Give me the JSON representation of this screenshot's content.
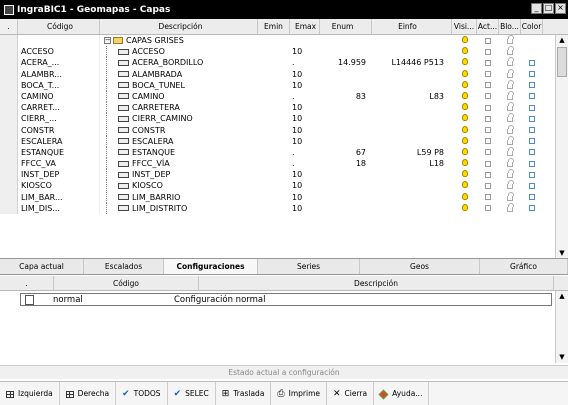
{
  "window": {
    "title": "IngraBIC1 - Geomapas - Capas",
    "buttons": [
      "_",
      "□",
      "×"
    ]
  },
  "grid": {
    "columns": [
      ".",
      "Código",
      "Descripción",
      "Emin",
      "Emax",
      "Enum",
      "Einfo",
      "Visi...",
      "Act...",
      "Blo...",
      "Color"
    ],
    "group_label": "CAPAS GRISES",
    "rows": [
      {
        "codigo": "ACCESO",
        "descripcion": "ACCESO",
        "emin": "",
        "emax": "10",
        "enum": "",
        "einfo": "",
        "color": false
      },
      {
        "codigo": "ACERA_...",
        "descripcion": "ACERA_BORDILLO",
        "emin": "",
        "emax": ".",
        "enum": "14.959",
        "einfo": "L14446 P513",
        "color": true
      },
      {
        "codigo": "ALAMBR...",
        "descripcion": "ALAMBRADA",
        "emin": "",
        "emax": "10",
        "enum": "",
        "einfo": "",
        "color": true
      },
      {
        "codigo": "BOCA_T...",
        "descripcion": "BOCA_TUNEL",
        "emin": "",
        "emax": "10",
        "enum": "",
        "einfo": "",
        "color": true
      },
      {
        "codigo": "CAMINO",
        "descripcion": "CAMINO",
        "emin": "",
        "emax": ".",
        "enum": "83",
        "einfo": "L83",
        "color": true
      },
      {
        "codigo": "CARRET...",
        "descripcion": "CARRETERA",
        "emin": "",
        "emax": "10",
        "enum": "",
        "einfo": "",
        "color": true
      },
      {
        "codigo": "CIERR_...",
        "descripcion": "CIERR_CAMINO",
        "emin": "",
        "emax": "10",
        "enum": "",
        "einfo": "",
        "color": true
      },
      {
        "codigo": "CONSTR",
        "descripcion": "CONSTR",
        "emin": "",
        "emax": "10",
        "enum": "",
        "einfo": "",
        "color": true
      },
      {
        "codigo": "ESCALERA",
        "descripcion": "ESCALERA",
        "emin": "",
        "emax": "10",
        "enum": "",
        "einfo": "",
        "color": true
      },
      {
        "codigo": "ESTANQUE",
        "descripcion": "ESTANQUE",
        "emin": "",
        "emax": ".",
        "enum": "67",
        "einfo": "L59 P8",
        "color": true
      },
      {
        "codigo": "FFCC_VA",
        "descripcion": "FFCC_VÍA",
        "emin": "",
        "emax": ".",
        "enum": "18",
        "einfo": "L18",
        "color": true
      },
      {
        "codigo": "INST_DEP",
        "descripcion": "INST_DEP",
        "emin": "",
        "emax": "10",
        "enum": "",
        "einfo": "",
        "color": true
      },
      {
        "codigo": "KIOSCO",
        "descripcion": "KIOSCO",
        "emin": "",
        "emax": "10",
        "enum": "",
        "einfo": "",
        "color": true
      },
      {
        "codigo": "LIM_BAR...",
        "descripcion": "LIM_BARRIO",
        "emin": "",
        "emax": "10",
        "enum": "",
        "einfo": "",
        "color": true
      },
      {
        "codigo": "LIM_DIS...",
        "descripcion": "LIM_DISTRITO",
        "emin": "",
        "emax": "10",
        "enum": "",
        "einfo": "",
        "color": true
      }
    ]
  },
  "tabs": [
    "Capa actual",
    "Escalados",
    "Configuraciones",
    "Series",
    "Geos",
    "Gráfico"
  ],
  "active_tab": "Configuraciones",
  "config": {
    "columns": [
      ".",
      "Código",
      "Descripción"
    ],
    "rows": [
      {
        "codigo": "normal",
        "descripcion": "Configuración normal"
      }
    ]
  },
  "status": "Estado actual a configuración",
  "toolbar": [
    {
      "label": "Izquierda",
      "icon": "grid-icon"
    },
    {
      "label": "Derecha",
      "icon": "grid-icon"
    },
    {
      "label": "TODOS",
      "icon": "check-icon"
    },
    {
      "label": "SELEC",
      "icon": "check-icon"
    },
    {
      "label": "Traslada",
      "icon": "move-icon"
    },
    {
      "label": "Imprime",
      "icon": "printer-icon"
    },
    {
      "label": "Cierra",
      "icon": "close-icon"
    },
    {
      "label": "Ayuda...",
      "icon": "help-icon"
    }
  ],
  "colors": {
    "titlebar": "#000000",
    "bulb": "#ffd800",
    "swatch": "#4a8bd6",
    "check": "#1a5fc6"
  }
}
